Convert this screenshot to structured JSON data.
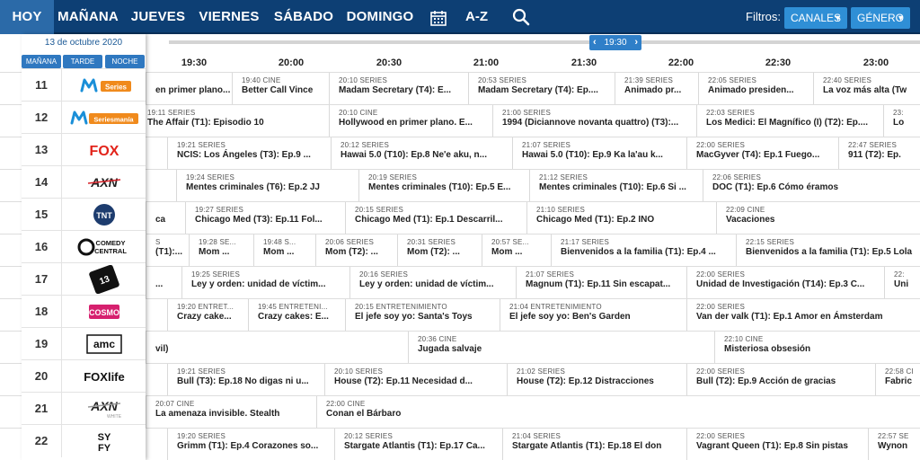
{
  "nav": {
    "days": [
      "HOY",
      "MAÑANA",
      "JUEVES",
      "VIERNES",
      "SÁBADO",
      "DOMINGO"
    ],
    "az": "A-Z",
    "filtros": "Filtros:",
    "canales": "CANALES",
    "genero": "GÉNERO",
    "calendar_icon": "calendar-icon",
    "search_icon": "search-icon"
  },
  "sidebar": {
    "date": "13 de octubre 2020",
    "periods": [
      "MAÑANA",
      "TARDE",
      "NOCHE"
    ],
    "channels": [
      {
        "num": "11",
        "logo": "M Series"
      },
      {
        "num": "12",
        "logo": "M Seriesmanía"
      },
      {
        "num": "13",
        "logo": "FOX"
      },
      {
        "num": "14",
        "logo": "AXN"
      },
      {
        "num": "15",
        "logo": "TNT"
      },
      {
        "num": "16",
        "logo": "COMEDY CENTRAL"
      },
      {
        "num": "17",
        "logo": "CALLE 13"
      },
      {
        "num": "18",
        "logo": "COSMO"
      },
      {
        "num": "19",
        "logo": "amc"
      },
      {
        "num": "20",
        "logo": "FOXlife"
      },
      {
        "num": "21",
        "logo": "AXN WHITE"
      },
      {
        "num": "22",
        "logo": "SYFY"
      }
    ]
  },
  "timeline": {
    "now_label": "19:30",
    "times": [
      "19:30",
      "20:00",
      "20:30",
      "21:00",
      "21:30",
      "22:00",
      "22:30",
      "23:00"
    ]
  },
  "grid": [
    [
      {
        "cat": "",
        "title": "en primer plano..."
      },
      {
        "cat": "19:40 CINE",
        "title": "Better Call Vince"
      },
      {
        "cat": "20:10 SERIES",
        "title": "Madam Secretary (T4): E..."
      },
      {
        "cat": "20:53 SERIES",
        "title": "Madam Secretary (T4): Ep...."
      },
      {
        "cat": "21:39 SERIES",
        "title": "Animado pr..."
      },
      {
        "cat": "22:05 SERIES",
        "title": "Animado presiden..."
      },
      {
        "cat": "22:40 SERIES",
        "title": "La voz más alta (Tw"
      }
    ],
    [
      {
        "cat": "19:11 SERIES",
        "title": "The Affair (T1): Episodio 10"
      },
      {
        "cat": "20:10 CINE",
        "title": "Hollywood en primer plano. E..."
      },
      {
        "cat": "21:00 SERIES",
        "title": "1994 (Diciannove novanta quattro) (T3):..."
      },
      {
        "cat": "22:03 SERIES",
        "title": "Los Medici: El Magnífico (I) (T2): Ep...."
      },
      {
        "cat": "23:",
        "title": "Lo"
      }
    ],
    [
      {
        "cat": "19:21 SERIES",
        "title": "NCIS: Los Ángeles (T3): Ep.9 ..."
      },
      {
        "cat": "20:12 SERIES",
        "title": "Hawai 5.0 (T10): Ep.8 Ne'e aku, n..."
      },
      {
        "cat": "21:07 SERIES",
        "title": "Hawai 5.0 (T10): Ep.9 Ka la'au k..."
      },
      {
        "cat": "22:00 SERIES",
        "title": "MacGyver (T4): Ep.1 Fuego..."
      },
      {
        "cat": "22:47 SERIES",
        "title": "911 (T2): Ep."
      }
    ],
    [
      {
        "cat": "19:24 SERIES",
        "title": "Mentes criminales (T6): Ep.2 JJ"
      },
      {
        "cat": "20:19 SERIES",
        "title": "Mentes criminales (T10): Ep.5 E..."
      },
      {
        "cat": "21:12 SERIES",
        "title": "Mentes criminales (T10): Ep.6 Si ..."
      },
      {
        "cat": "22:06 SERIES",
        "title": "DOC (T1): Ep.6 Cómo éramos"
      }
    ],
    [
      {
        "cat": "",
        "title": "ca"
      },
      {
        "cat": "19:27 SERIES",
        "title": "Chicago Med (T3): Ep.11 Fol..."
      },
      {
        "cat": "20:15 SERIES",
        "title": "Chicago Med (T1): Ep.1 Descarril..."
      },
      {
        "cat": "21:10 SERIES",
        "title": "Chicago Med (T1): Ep.2 INO"
      },
      {
        "cat": "22:09 CINE",
        "title": "Vacaciones"
      }
    ],
    [
      {
        "cat": "S",
        "title": "(T1):..."
      },
      {
        "cat": "19:28 SE...",
        "title": "Mom ..."
      },
      {
        "cat": "19:48 S...",
        "title": "Mom ..."
      },
      {
        "cat": "20:06 SERIES",
        "title": "Mom (T2): ..."
      },
      {
        "cat": "20:31 SERIES",
        "title": "Mom (T2): ..."
      },
      {
        "cat": "20:57 SE...",
        "title": "Mom ..."
      },
      {
        "cat": "21:17 SERIES",
        "title": "Bienvenidos a la familia (T1): Ep.4 ..."
      },
      {
        "cat": "22:15 SERIES",
        "title": "Bienvenidos a la familia (T1): Ep.5 Lola"
      }
    ],
    [
      {
        "cat": "",
        "title": "..."
      },
      {
        "cat": "19:25 SERIES",
        "title": "Ley y orden: unidad de víctim..."
      },
      {
        "cat": "20:16 SERIES",
        "title": "Ley y orden: unidad de víctim..."
      },
      {
        "cat": "21:07 SERIES",
        "title": "Magnum (T1): Ep.11 Sin escapat..."
      },
      {
        "cat": "22:00 SERIES",
        "title": "Unidad de Investigación (T14): Ep.3 C..."
      },
      {
        "cat": "22:",
        "title": "Uni"
      }
    ],
    [
      {
        "cat": "19:20 ENTRET...",
        "title": "Crazy cake..."
      },
      {
        "cat": "19:45 ENTRETENI...",
        "title": "Crazy cakes: E..."
      },
      {
        "cat": "20:15 ENTRETENIMIENTO",
        "title": "El jefe soy yo: Santa's Toys"
      },
      {
        "cat": "21:04 ENTRETENIMIENTO",
        "title": "El jefe soy yo: Ben's Garden"
      },
      {
        "cat": "22:00 SERIES",
        "title": "Van der valk (T1): Ep.1 Amor en Ámsterdam"
      }
    ],
    [
      {
        "cat": "",
        "title": "vil)"
      },
      {
        "cat": "20:36 CINE",
        "title": "Jugada salvaje"
      },
      {
        "cat": "22:10 CINE",
        "title": "Misteriosa obsesión"
      }
    ],
    [
      {
        "cat": "19:21 SERIES",
        "title": "Bull (T3): Ep.18 No digas ni u..."
      },
      {
        "cat": "20:10 SERIES",
        "title": "House (T2): Ep.11 Necesidad d..."
      },
      {
        "cat": "21:02 SERIES",
        "title": "House (T2): Ep.12 Distracciones"
      },
      {
        "cat": "22:00 SERIES",
        "title": "Bull (T2): Ep.9 Acción de gracias"
      },
      {
        "cat": "22:58 CI",
        "title": "Fabric"
      }
    ],
    [
      {
        "cat": "20:07 CINE",
        "title": "La amenaza invisible. Stealth"
      },
      {
        "cat": "22:00 CINE",
        "title": "Conan el Bárbaro"
      }
    ],
    [
      {
        "cat": "19:20 SERIES",
        "title": "Grimm (T1): Ep.4 Corazones so..."
      },
      {
        "cat": "20:12 SERIES",
        "title": "Stargate Atlantis (T1): Ep.17 Ca..."
      },
      {
        "cat": "21:04 SERIES",
        "title": "Stargate Atlantis (T1): Ep.18 El don"
      },
      {
        "cat": "22:00 SERIES",
        "title": "Vagrant Queen (T1): Ep.8 Sin pistas"
      },
      {
        "cat": "22:57 SE",
        "title": "Wynon"
      }
    ]
  ]
}
